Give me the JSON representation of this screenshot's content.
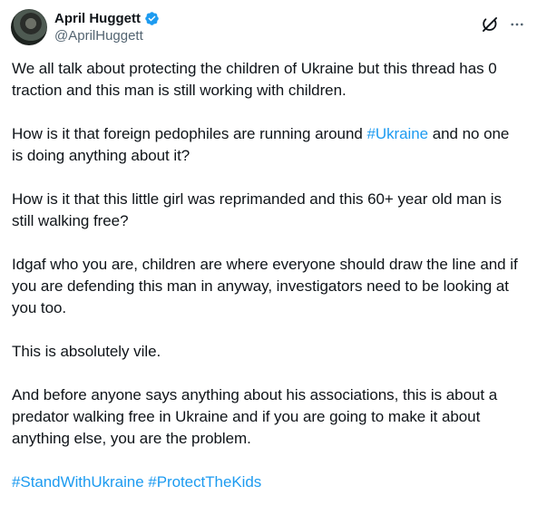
{
  "author": {
    "display_name": "April Huggett",
    "handle": "@AprilHuggett",
    "verified": true,
    "verified_color": "#1d9bf0",
    "avatar_icon": "profile-photo"
  },
  "header_actions": {
    "grok_icon": "grok-icon",
    "more_icon": "more-horizontal-icon"
  },
  "tweet": {
    "p1": "We all talk about protecting the children of Ukraine but this thread has 0 traction and this man is still working with children.",
    "p2_before": "How is it that foreign pedophiles are running around ",
    "p2_hashtag": "#Ukraine",
    "p2_after": " and no one is doing anything about it?",
    "p3": "How is it that this little girl was reprimanded and this 60+ year old man is still walking free?",
    "p4": "Idgaf who you are, children are where everyone should draw the line and if you are defending this man in anyway, investigators need to be looking at you too.",
    "p5": "This is absolutely vile.",
    "p6": "And before anyone says anything about his associations, this is about a predator walking free in Ukraine and if you are going to make it about anything else, you are the problem.",
    "hashtags": [
      "#StandWithUkraine",
      "#ProtectTheKids"
    ]
  },
  "colors": {
    "text": "#0f1419",
    "secondary": "#536471",
    "link": "#1d9bf0"
  }
}
